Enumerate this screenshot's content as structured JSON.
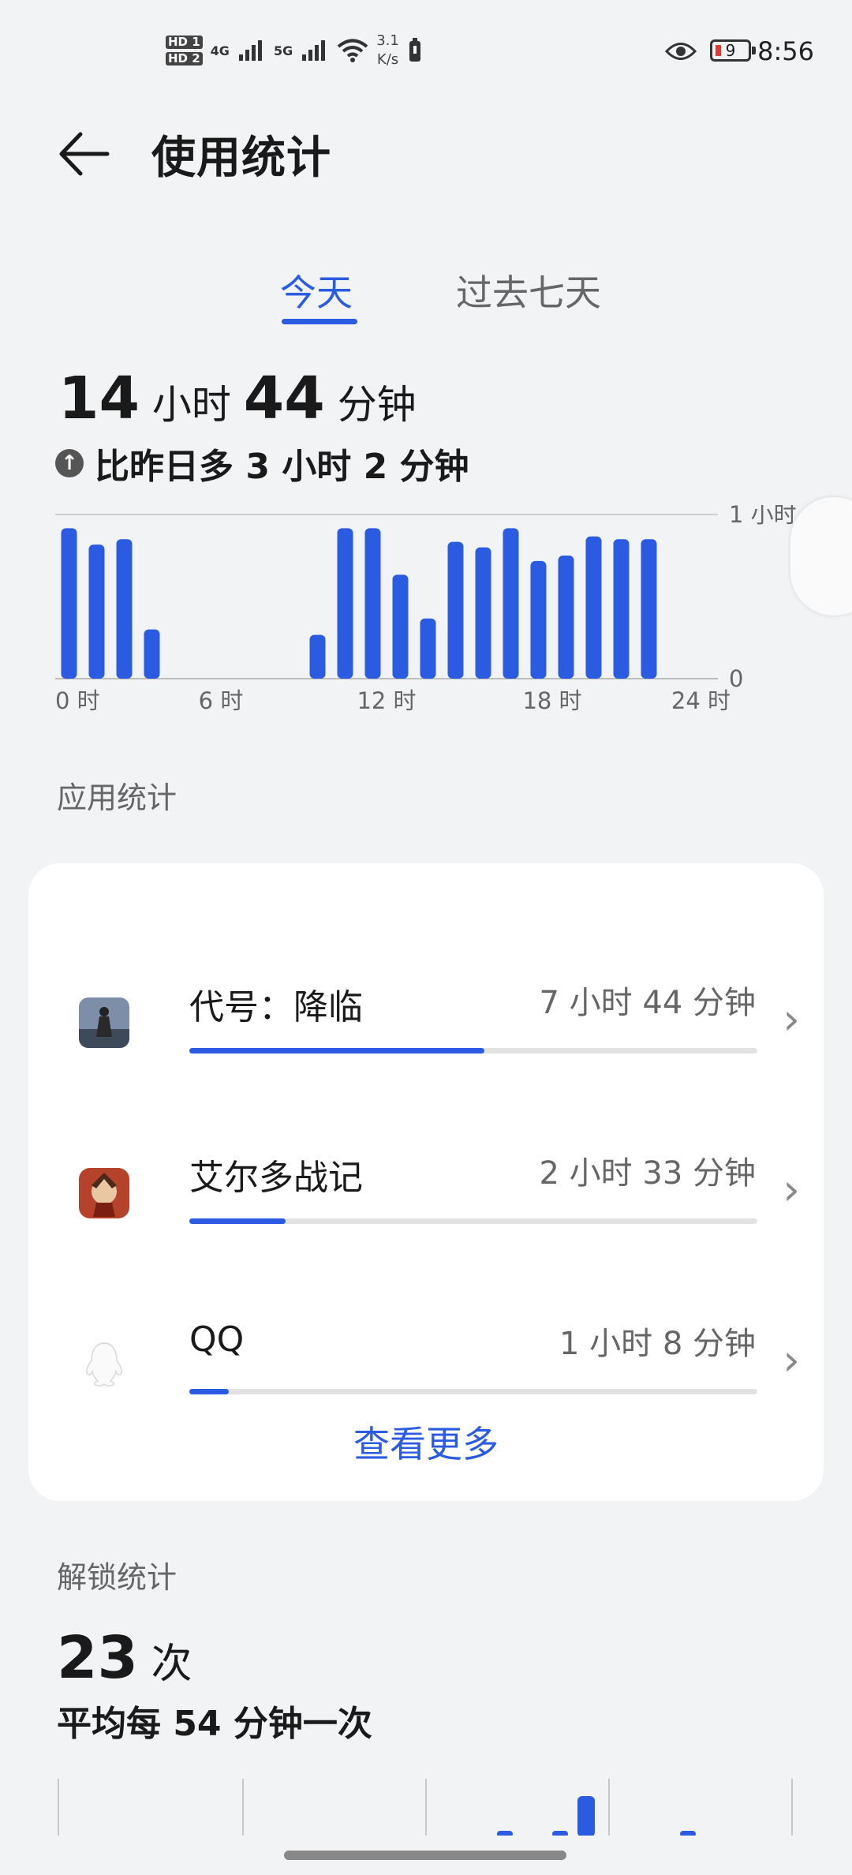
{
  "status_bar": {
    "hd1": "HD 1",
    "hd2": "HD 2",
    "net1": "4G",
    "net2": "5G",
    "speed_value": "3.1",
    "speed_unit": "K/s",
    "battery": "9",
    "time": "8:56"
  },
  "header": {
    "title": "使用统计"
  },
  "tabs": [
    {
      "label": "今天"
    },
    {
      "label": "过去七天"
    }
  ],
  "summary": {
    "hours": "14",
    "hours_unit": "小时",
    "minutes": "44",
    "minutes_unit": "分钟",
    "compare": "比昨日多 3 小时 2 分钟"
  },
  "chart_data": {
    "type": "bar",
    "x_tick_labels": [
      "0 时",
      "6 时",
      "12 时",
      "18 时",
      "24 时"
    ],
    "y_tick_labels": [
      "1 小时",
      "0"
    ],
    "xlim": [
      0,
      24
    ],
    "ylim": [
      0,
      60
    ],
    "x": [
      0.5,
      1.5,
      2.5,
      3.5,
      9.5,
      10.5,
      11.5,
      12.5,
      13.5,
      14.5,
      15.5,
      16.5,
      17.5,
      18.5,
      19.5,
      20.5,
      21.5
    ],
    "values": [
      55,
      49,
      51,
      18,
      16,
      55,
      55,
      38,
      22,
      50,
      48,
      55,
      43,
      45,
      52,
      51,
      51
    ],
    "color": "#2b5be0"
  },
  "app_section": {
    "label": "应用统计"
  },
  "apps": [
    {
      "name": "代号：降临",
      "time": "7 小时 44 分钟",
      "fraction": 0.52,
      "icon": "game-soldier-icon"
    },
    {
      "name": "艾尔多战记",
      "time": "2 小时 33 分钟",
      "fraction": 0.17,
      "icon": "game-warrior-icon"
    },
    {
      "name": "QQ",
      "time": "1 小时 8 分钟",
      "fraction": 0.07,
      "icon": "qq-penguin-icon"
    }
  ],
  "view_more": "查看更多",
  "unlock": {
    "section_label": "解锁统计",
    "count": "23",
    "count_unit": "次",
    "average": "平均每 54 分钟一次"
  },
  "accent_color": "#2b5be0"
}
